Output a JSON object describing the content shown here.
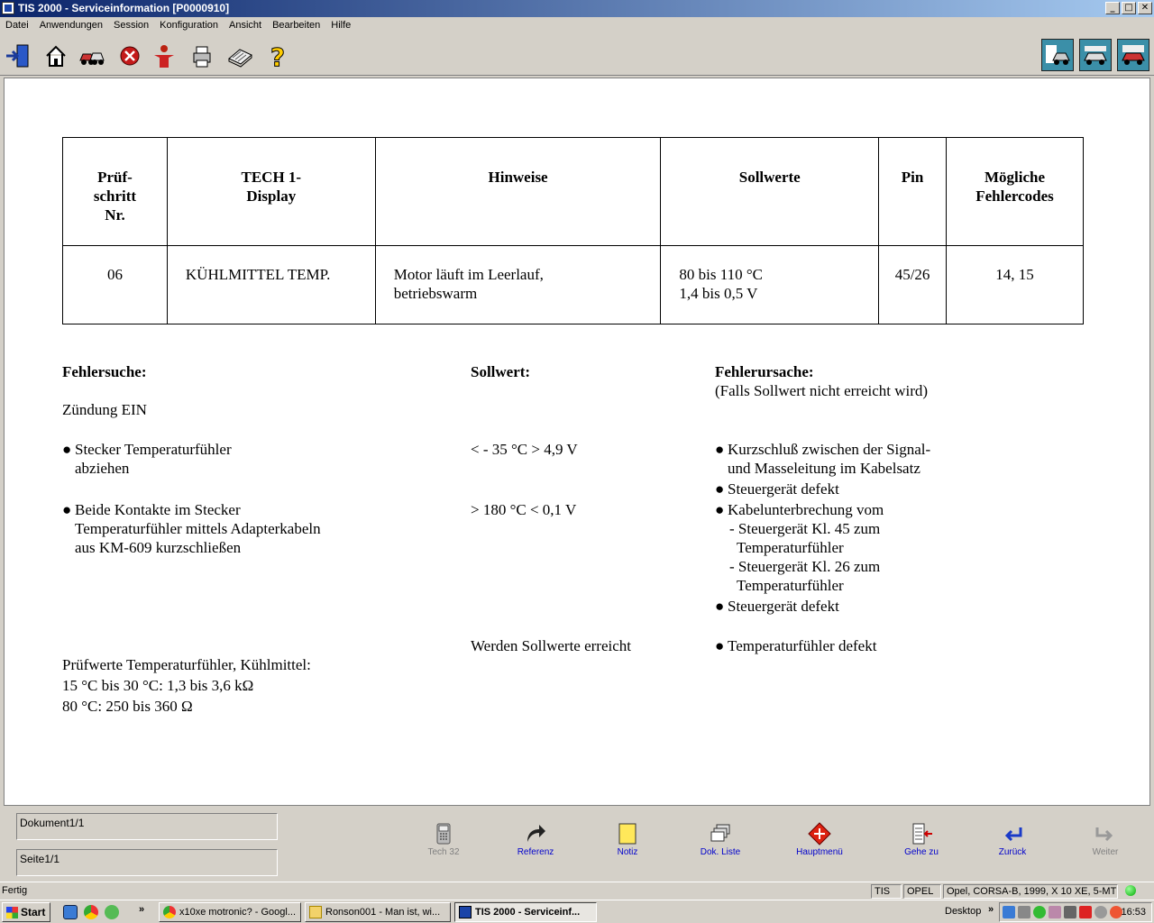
{
  "window": {
    "title": "TIS 2000 - Serviceinformation [P0000910]",
    "min": "_",
    "max": "□",
    "close": "✕"
  },
  "menu": [
    "Datei",
    "Anwendungen",
    "Session",
    "Konfiguration",
    "Ansicht",
    "Bearbeiten",
    "Hilfe"
  ],
  "table": {
    "headers": [
      [
        "Prüf-",
        "schritt",
        "Nr."
      ],
      [
        "TECH 1-",
        "Display"
      ],
      [
        "Hinweise"
      ],
      [
        "Sollwerte"
      ],
      [
        "Pin"
      ],
      [
        "Mögliche",
        "Fehlercodes"
      ]
    ],
    "row": {
      "step": "06",
      "display": "KÜHLMITTEL TEMP.",
      "hint_1": "Motor läuft im Leerlauf,",
      "hint_2": "betriebswarm",
      "soll_1": "80 bis 110 °C",
      "soll_2": "1,4 bis 0,5 V",
      "pin": "45/26",
      "codes": "14, 15"
    }
  },
  "section": {
    "fehlersuche_title": "Fehlersuche:",
    "sollwert_title": "Sollwert:",
    "ursache_title": "Fehlerursache:",
    "ursache_sub": "(Falls Sollwert nicht erreicht wird)",
    "zuendung": "Zündung EIN",
    "step1_l1": "Stecker Temperaturfühler",
    "step1_l2": "abziehen",
    "step1_soll": "< - 35 °C > 4,9 V",
    "cause1_l1": "Kurzschluß zwischen der Signal-",
    "cause1_l2": "und Masseleitung im Kabelsatz",
    "cause2": "Steuergerät defekt",
    "step2_l1": "Beide Kontakte im Stecker",
    "step2_l2": "Temperaturfühler mittels Adapterkabeln",
    "step2_l3": "aus KM-609 kurzschließen",
    "step2_soll": "> 180 °C < 0,1 V",
    "cause3": "Kabelunterbrechung vom",
    "cause3_a1": "- Steuergerät Kl. 45 zum",
    "cause3_a2": "Temperaturfühler",
    "cause3_b1": "- Steuergerät Kl. 26 zum",
    "cause3_b2": "Temperaturfühler",
    "cause4": "Steuergerät defekt",
    "reached": "Werden Sollwerte erreicht",
    "cause5": "Temperaturfühler defekt",
    "pruef_title": "Prüfwerte Temperaturfühler, Kühlmittel:",
    "pruef_1": "15 °C bis 30 °C: 1,3 bis 3,6 kΩ",
    "pruef_2": "80 °C: 250 bis 360 Ω",
    "bullet": "●"
  },
  "bottom": {
    "doc_field": "Dokument1/1",
    "page_field": "Seite1/1",
    "buttons": [
      "Tech 32",
      "Referenz",
      "Notiz",
      "Dok. Liste",
      "Hauptmenü",
      "Gehe zu",
      "Zurück",
      "Weiter"
    ]
  },
  "status": {
    "left": "Fertig",
    "tis": "TIS",
    "make": "OPEL",
    "vehicle": "Opel, CORSA-B, 1999, X 10 XE, 5-MT"
  },
  "taskbar": {
    "start": "Start",
    "chevron": "»",
    "tasks": [
      "x10xe motronic? - Googl...",
      "Ronson001 - Man ist, wi...",
      "TIS 2000 - Serviceinf..."
    ],
    "desktop": "Desktop",
    "clock": "16:53"
  }
}
